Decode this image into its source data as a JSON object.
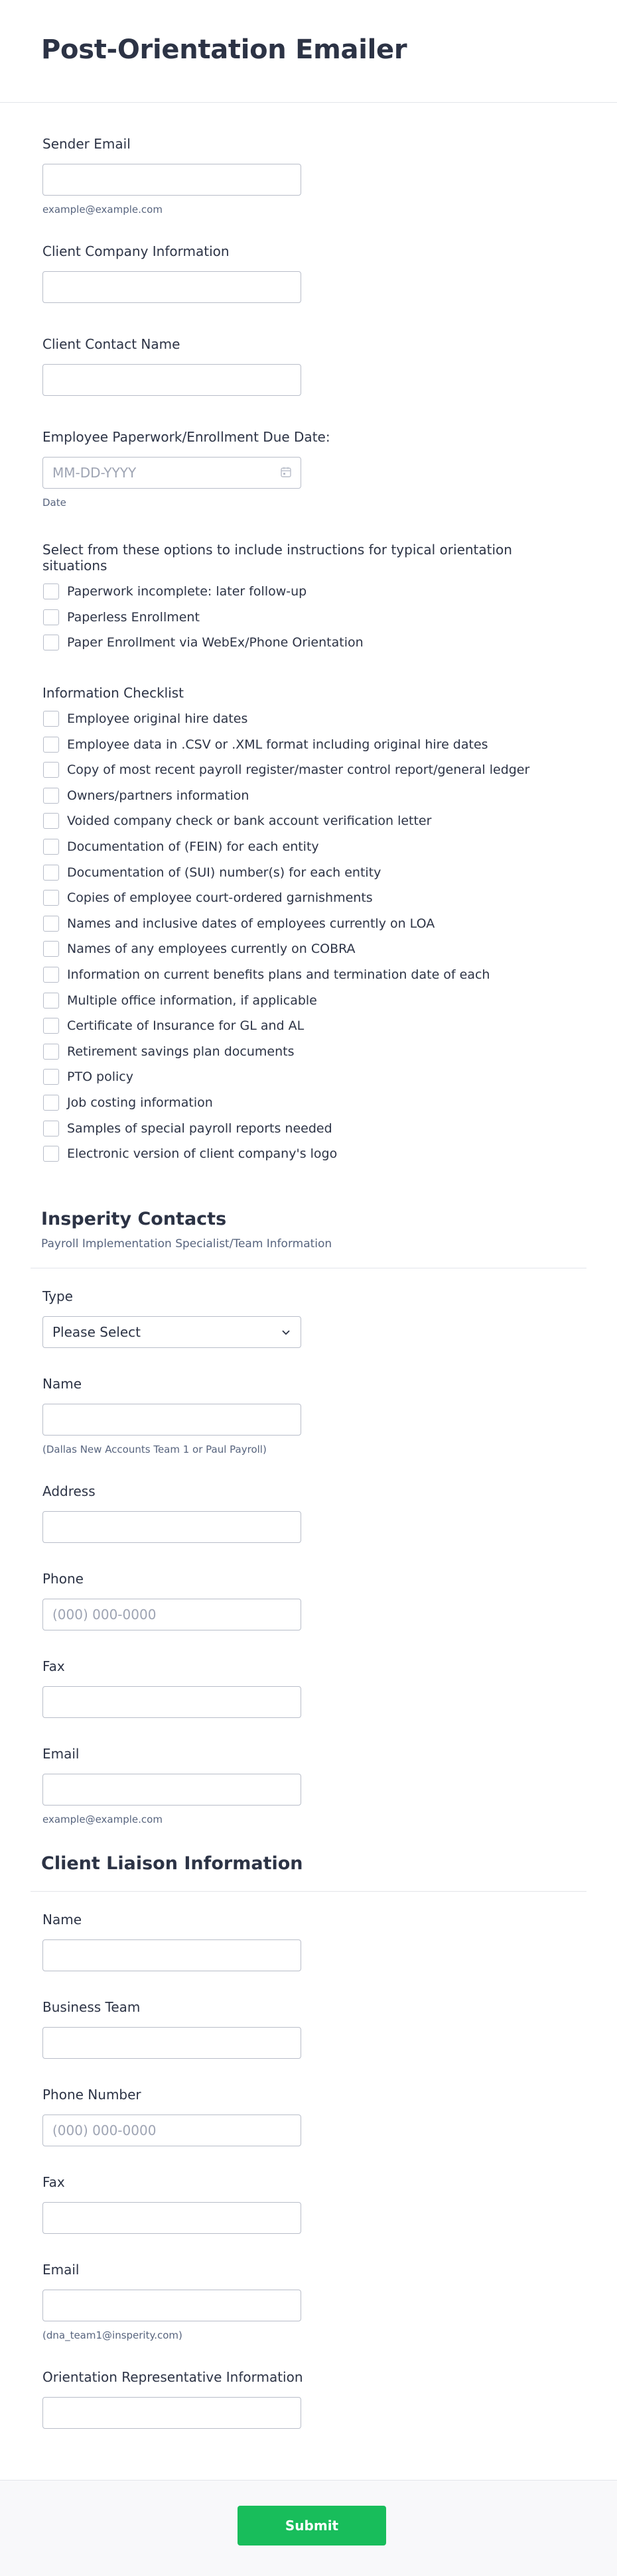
{
  "form": {
    "title": "Post-Orientation Emailer"
  },
  "fields": {
    "sender_email": {
      "label": "Sender Email",
      "value": "",
      "sublabel": "example@example.com"
    },
    "client_company": {
      "label": "Client Company Information",
      "value": ""
    },
    "client_contact": {
      "label": "Client Contact Name",
      "value": ""
    },
    "due_date": {
      "label": "Employee Paperwork/Enrollment Due Date:",
      "placeholder": "MM-DD-YYYY",
      "sublabel": "Date",
      "icon": "calendar-icon"
    }
  },
  "orientation_options": {
    "label": "Select from these options to include instructions for typical orientation situations",
    "items": [
      "Paperwork incomplete: later follow-up",
      "Paperless Enrollment",
      "Paper Enrollment via WebEx/Phone Orientation"
    ]
  },
  "info_checklist": {
    "label": "Information Checklist",
    "items": [
      "Employee original hire dates",
      "Employee data in .CSV or .XML format including original hire dates",
      "Copy of most recent payroll register/master control report/general ledger",
      "Owners/partners information",
      "Voided company check or bank account verification letter",
      "Documentation of (FEIN) for each entity",
      "Documentation of (SUI) number(s) for each entity",
      "Copies of employee court-ordered garnishments",
      "Names and inclusive dates of employees currently on LOA",
      "Names of any employees currently on COBRA",
      "Information on current benefits plans and termination date of each",
      "Multiple office information, if applicable",
      "Certificate of Insurance for GL and AL",
      "Retirement savings plan documents",
      "PTO policy",
      "Job costing information",
      "Samples of special payroll reports needed",
      "Electronic version of client company's logo"
    ]
  },
  "insperity": {
    "title": "Insperity Contacts",
    "subtitle": "Payroll Implementation Specialist/Team Information",
    "type": {
      "label": "Type",
      "selected": "Please Select",
      "icon": "chevron-down-icon"
    },
    "name": {
      "label": "Name",
      "value": "",
      "sublabel": "(Dallas New Accounts Team 1 or Paul Payroll)"
    },
    "address": {
      "label": "Address",
      "value": ""
    },
    "phone": {
      "label": "Phone",
      "placeholder": "(000) 000-0000"
    },
    "fax": {
      "label": "Fax",
      "value": ""
    },
    "email": {
      "label": "Email",
      "value": "",
      "sublabel": "example@example.com"
    }
  },
  "liaison": {
    "title": "Client Liaison Information",
    "name": {
      "label": "Name",
      "value": ""
    },
    "business_team": {
      "label": "Business Team",
      "value": ""
    },
    "phone": {
      "label": "Phone Number",
      "placeholder": "(000) 000-0000"
    },
    "fax": {
      "label": "Fax",
      "value": ""
    },
    "email": {
      "label": "Email",
      "value": "",
      "sublabel": "(dna_team1@insperity.com)"
    },
    "orientation_rep": {
      "label": "Orientation Representative Information",
      "value": ""
    }
  },
  "footer": {
    "submit_label": "Submit"
  },
  "colors": {
    "text": "#2c3345",
    "sublabel": "#57647e",
    "border": "#b8bdc9",
    "submit": "#18bd5b"
  }
}
